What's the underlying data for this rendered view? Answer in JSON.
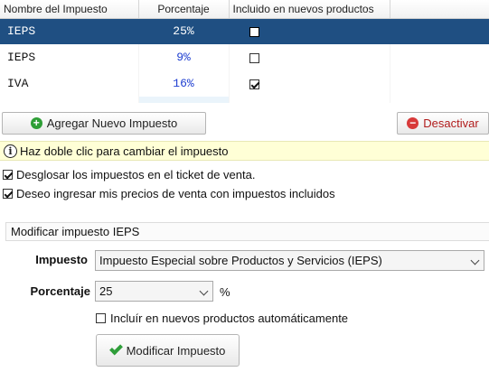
{
  "table": {
    "headers": [
      "Nombre del Impuesto",
      "Porcentaje",
      "Incluido en nuevos productos"
    ],
    "rows": [
      {
        "name": "IEPS",
        "percent": "25%",
        "included": false,
        "selected": true
      },
      {
        "name": "IEPS",
        "percent": "9%",
        "included": false,
        "selected": false
      },
      {
        "name": "IVA",
        "percent": "16%",
        "included": true,
        "selected": false
      }
    ]
  },
  "buttons": {
    "add_label": "Agregar Nuevo Impuesto",
    "add_icon": "plus-circle-icon",
    "deactivate_label": "Desactivar",
    "deactivate_icon": "minus-circle-icon"
  },
  "info": {
    "icon": "info-icon",
    "text": "Haz doble clic para cambiar el impuesto"
  },
  "options": {
    "breakdown_label": "Desglosar los impuestos en el ticket de venta.",
    "breakdown_checked": true,
    "include_prices_label": "Deseo ingresar mis precios de venta con impuestos incluidos",
    "include_prices_checked": true
  },
  "edit": {
    "title": "Modificar impuesto IEPS",
    "tax_label": "Impuesto",
    "tax_value": "Impuesto Especial sobre Productos y Servicios (IEPS)",
    "percent_label": "Porcentaje",
    "percent_value": "25",
    "percent_unit": "%",
    "auto_include_label": "Incluír en nuevos productos automáticamente",
    "auto_include_checked": false,
    "modify_label": "Modificar Impuesto",
    "modify_icon": "check-icon"
  },
  "colors": {
    "selected_row": "#1f4f82",
    "percent_text": "#1f3fd1",
    "info_bg": "#ffffd6",
    "deactivate_text": "#b01b1b"
  }
}
